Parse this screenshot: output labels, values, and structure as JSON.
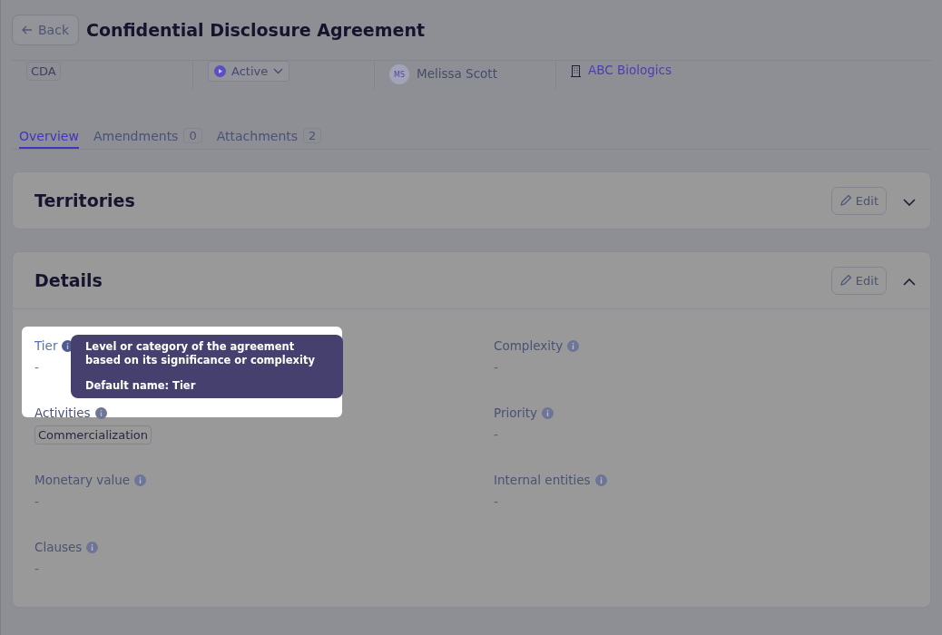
{
  "header": {
    "back": "Back",
    "title": "Confidential Disclosure Agreement"
  },
  "meta": {
    "type": "CDA",
    "status": "Active",
    "owner": {
      "initials": "MS",
      "name": "Melissa Scott"
    },
    "company": "ABC Biologics"
  },
  "tabs": [
    {
      "label": "Overview",
      "selected": true
    },
    {
      "label": "Amendments",
      "count": "0",
      "selected": false
    },
    {
      "label": "Attachments",
      "count": "2",
      "selected": false
    }
  ],
  "sections": [
    {
      "title": "Territories",
      "edit": "Edit",
      "expanded": false
    },
    {
      "title": "Details",
      "edit": "Edit",
      "expanded": true,
      "fields": [
        {
          "label": "Tier",
          "value": "-",
          "highlighted": true
        },
        {
          "label": "Complexity",
          "value": "-",
          "highlighted": false
        },
        {
          "label": "Activities",
          "tags": [
            "Commercialization"
          ],
          "highlighted": false
        },
        {
          "label": "Priority",
          "value": "-",
          "highlighted": false
        },
        {
          "label": "Monetary value",
          "value": "-",
          "highlighted": false
        },
        {
          "label": "Internal entities",
          "value": "-",
          "highlighted": false
        },
        {
          "label": "Clauses",
          "value": "-",
          "highlighted": false
        }
      ]
    }
  ],
  "tooltip": {
    "text": "Level or category of the agreement based on its significance or complexity",
    "default_name": "Default name: Tier"
  }
}
